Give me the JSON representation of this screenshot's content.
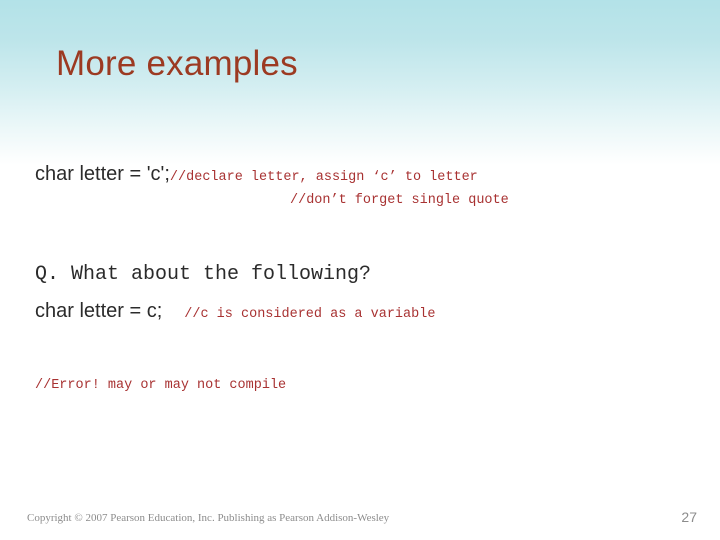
{
  "slide": {
    "title": "More examples",
    "title_color": "#9c3a22",
    "background_top_color": "#b3e2e8",
    "background_bottom_color": "#ffffff",
    "code_color": "#2b2b2b",
    "comment_color": "#a83232"
  },
  "content": {
    "declaration_line": {
      "code": "char letter = 'c';",
      "comment": "//declare letter, assign ‘c’ to letter",
      "comment_second_line": "//don’t forget single quote"
    },
    "question_line": "Q. What about the following?",
    "second_declaration": {
      "code": "char letter = c;",
      "comment": "//c is considered as a variable"
    },
    "error_note": "//Error! may or may not compile"
  },
  "footer": {
    "copyright": "Copyright © 2007 Pearson Education, Inc. Publishing as Pearson Addison-Wesley",
    "page_number": "27"
  }
}
